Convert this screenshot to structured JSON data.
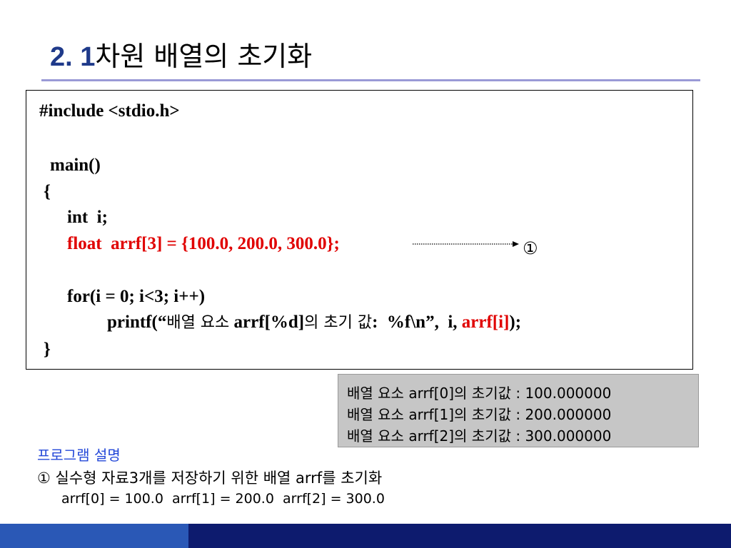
{
  "slide": {
    "title_num": "2. 1",
    "title_text": "차원 배열의 초기화"
  },
  "code": {
    "line1": "#include <stdio.h>",
    "line2": "main()",
    "line3": "{",
    "line4": "int  i;",
    "line5": "float  arrf[3] = {100.0, 200.0, 300.0};",
    "line6": "for(i = 0; i<3; i++)",
    "line7_a": "printf(“",
    "line7_ko1": "배열 요소",
    "line7_b": " arrf[%d]",
    "line7_ko2": "의 초기 값",
    "line7_c": ":  %f\\n”,  i, ",
    "line7_red": "arrf[i]",
    "line7_d": ");",
    "line8": "}"
  },
  "annotation": {
    "marker": "①"
  },
  "output": [
    "배열 요소 arrf[0]의 초기값 : 100.000000",
    "배열 요소 arrf[1]의 초기값 : 200.000000",
    "배열 요소 arrf[2]의 초기값 : 300.000000"
  ],
  "description": {
    "title": "프로그램 설명",
    "line1": "① 실수형 자료3개를 저장하기 위한 배열 arrf를 초기화",
    "line2": "arrf[0] = 100.0  arrf[1] = 200.0  arrf[2] = 300.0"
  },
  "colors": {
    "rule": "#9a9ad6",
    "title_num": "#1f3a8a",
    "red_code": "#e00000",
    "desc_title": "#2448d8",
    "footer_left": "#2a58b6",
    "footer_right": "#0d1b6e",
    "output_bg": "#c6c6c6"
  }
}
